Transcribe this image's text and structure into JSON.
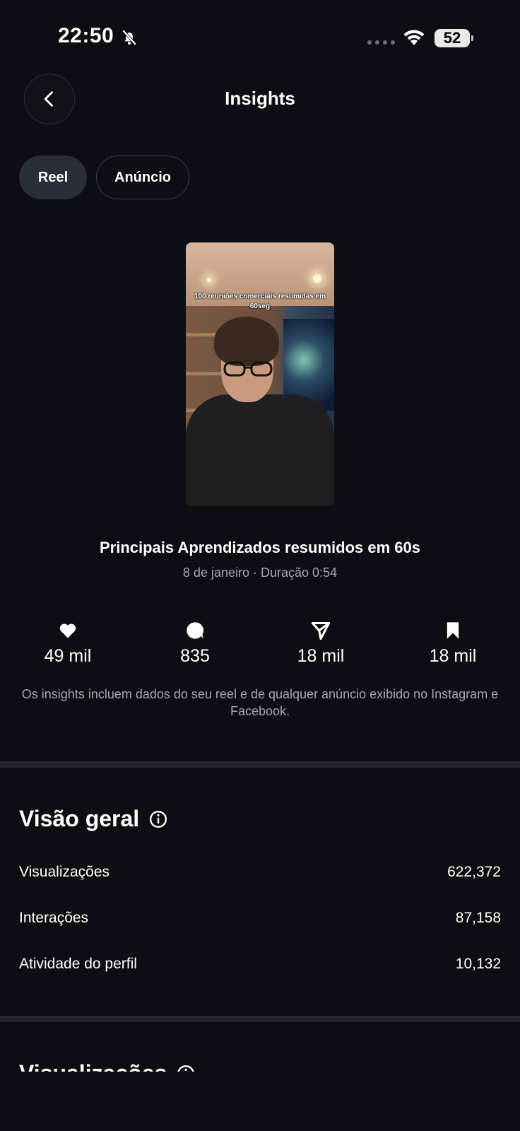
{
  "status_bar": {
    "time": "22:50",
    "battery": "52"
  },
  "header": {
    "title": "Insights"
  },
  "tabs": [
    {
      "label": "Reel",
      "selected": true
    },
    {
      "label": "Anúncio",
      "selected": false
    }
  ],
  "post": {
    "thumbnail_caption": "100 reuniões comerciais resumidas em 60seg",
    "title": "Principais Aprendizados resumidos em 60s",
    "meta": "8 de janeiro · Duração 0:54"
  },
  "stats": [
    {
      "icon": "heart-icon",
      "value": "49 mil"
    },
    {
      "icon": "comment-icon",
      "value": "835"
    },
    {
      "icon": "share-icon",
      "value": "18 mil"
    },
    {
      "icon": "bookmark-icon",
      "value": "18 mil"
    }
  ],
  "insights_note": "Os insights incluem dados do seu reel e de qualquer anúncio exibido no Instagram e Facebook.",
  "overview": {
    "title": "Visão geral",
    "rows": [
      {
        "label": "Visualizações",
        "value": "622,372"
      },
      {
        "label": "Interações",
        "value": "87,158"
      },
      {
        "label": "Atividade do perfil",
        "value": "10,132"
      }
    ]
  },
  "next_section": {
    "title": "Visualizações"
  },
  "colors": {
    "background": "#0b0f14",
    "muted_text": "#a3a8ae",
    "divider": "#23272d"
  }
}
